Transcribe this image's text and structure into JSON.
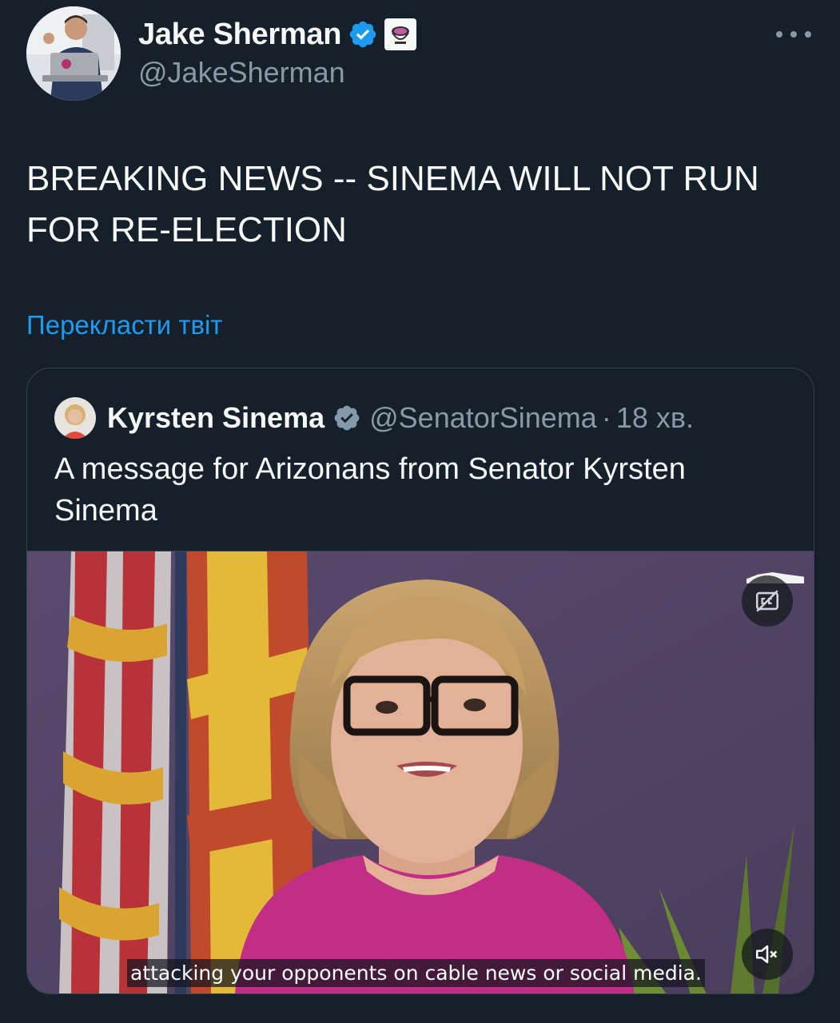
{
  "author": {
    "display_name": "Jake Sherman",
    "handle": "@JakeSherman",
    "avatar_icon": "profile-photo",
    "verified_icon": "verified-badge-icon",
    "affiliation_icon": "affiliate-logo-icon"
  },
  "tweet": {
    "text": "BREAKING NEWS -- SINEMA WILL NOT RUN\nFOR RE-ELECTION",
    "translate_label": "Перекласти твіт"
  },
  "quoted_tweet": {
    "display_name": "Kyrsten Sinema",
    "handle": "@SenatorSinema",
    "separator": "·",
    "time": "18 хв.",
    "text": "A message for Arizonans from Senator Kyrsten Sinema",
    "video": {
      "caption": "attacking your opponents on cable news or social media.",
      "cc_icon": "closed-captions-off-icon",
      "mute_icon": "muted-speaker-icon"
    }
  },
  "colors": {
    "background": "#15202b",
    "text_primary": "#f7f9f9",
    "text_secondary": "#8b98a5",
    "link": "#1d9bf0",
    "verified": "#1d9bf0",
    "border": "#38444d"
  }
}
